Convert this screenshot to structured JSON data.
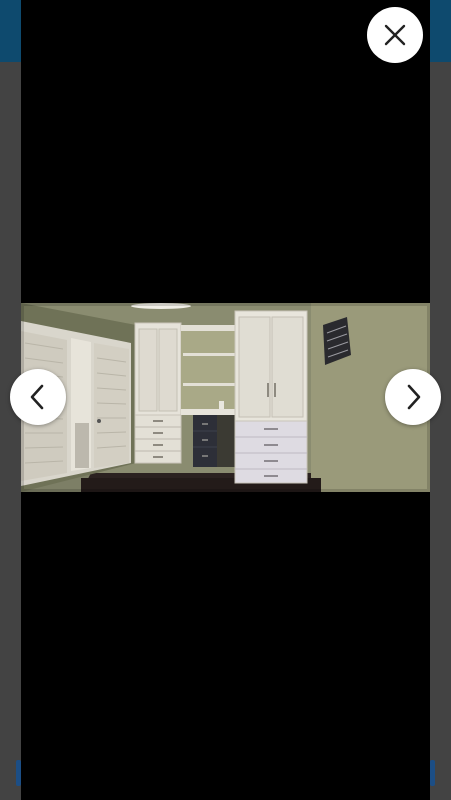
{
  "lightbox": {
    "photo": {
      "subject": "room-with-built-in-white-cabinets-and-desk"
    },
    "close_button": {
      "icon": "close-icon",
      "color": "#222222"
    },
    "prev_button": {
      "icon": "chevron-left-icon",
      "color": "#222222"
    },
    "next_button": {
      "icon": "chevron-right-icon",
      "color": "#222222"
    }
  },
  "colors": {
    "overlay": "#000000",
    "header": "#0e4a6e",
    "button_bg": "#ffffff"
  }
}
